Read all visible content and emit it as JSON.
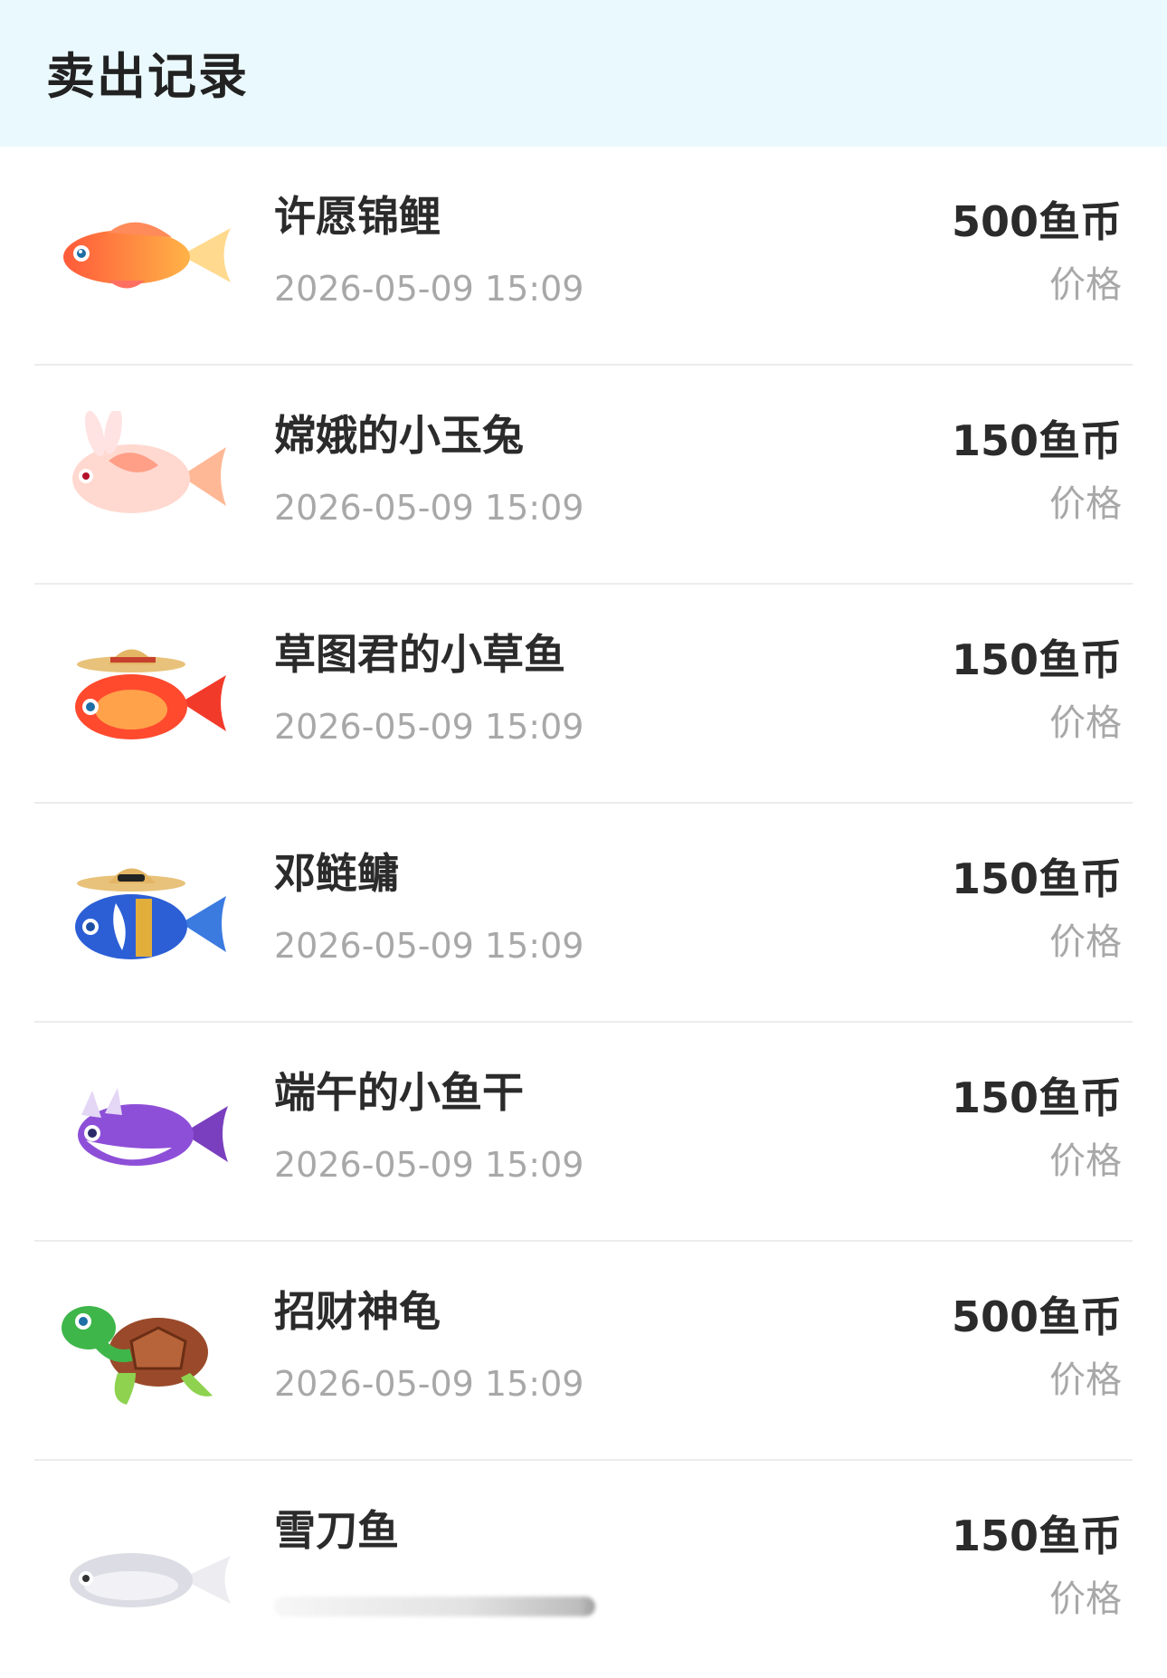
{
  "header": {
    "title": "卖出记录"
  },
  "price_label": "价格",
  "records": [
    {
      "name": "许愿锦鲤",
      "time": "2026-05-09 15:09",
      "price": "500鱼币",
      "icon": "koi-fish-icon"
    },
    {
      "name": "嫦娥的小玉兔",
      "time": "2026-05-09 15:09",
      "price": "150鱼币",
      "icon": "rabbit-fish-icon"
    },
    {
      "name": "草图君的小草鱼",
      "time": "2026-05-09 15:09",
      "price": "150鱼币",
      "icon": "hat-goldfish-icon"
    },
    {
      "name": "邓鲢鳙",
      "time": "2026-05-09 15:09",
      "price": "150鱼币",
      "icon": "blue-hat-fish-icon"
    },
    {
      "name": "端午的小鱼干",
      "time": "2026-05-09 15:09",
      "price": "150鱼币",
      "icon": "purple-fish-icon"
    },
    {
      "name": "招财神龟",
      "time": "2026-05-09 15:09",
      "price": "500鱼币",
      "icon": "turtle-icon"
    },
    {
      "name": "雪刀鱼",
      "time": "",
      "price": "150鱼币",
      "icon": "white-fish-icon"
    }
  ],
  "colors": {
    "header_bg": "#eaf9fd",
    "text_primary": "#2b2b2b",
    "text_secondary": "#a8a8a8",
    "divider": "#ececec"
  }
}
